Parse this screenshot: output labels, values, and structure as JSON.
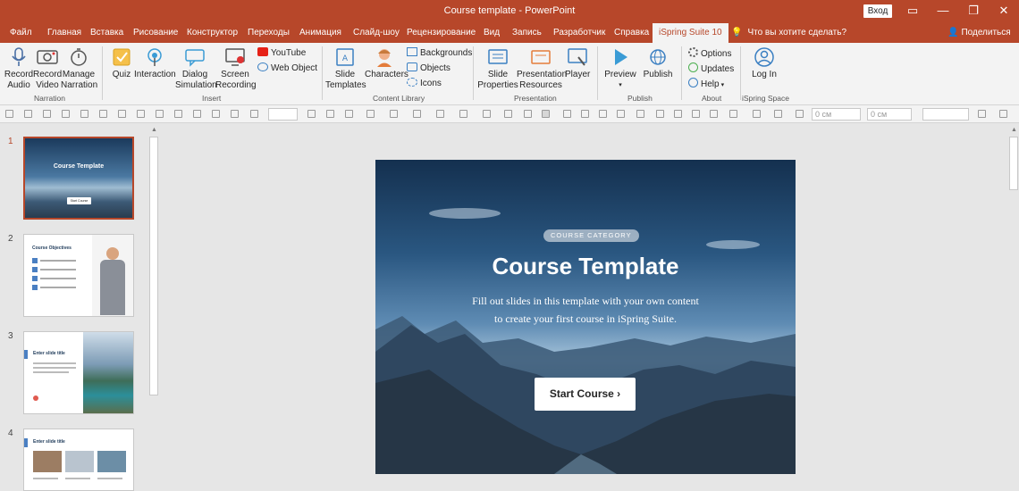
{
  "window": {
    "title": "Course template  -  PowerPoint",
    "login_label": "Вход",
    "controls": [
      "restore-ribbon",
      "minimize",
      "maximize",
      "close"
    ]
  },
  "tabs": [
    "Файл",
    "Главная",
    "Вставка",
    "Рисование",
    "Конструктор",
    "Переходы",
    "Анимация",
    "Слайд-шоу",
    "Рецензирование",
    "Вид",
    "Запись",
    "Разработчик",
    "Справка",
    "iSpring Suite 10"
  ],
  "active_tab": "iSpring Suite 10",
  "tell_me": "Что вы хотите сделать?",
  "share_label": "Поделиться",
  "ribbon": {
    "narration": {
      "record_audio": "Record Audio",
      "record_video": "Record Video",
      "manage_narration": "Manage Narration",
      "group": "Narration"
    },
    "insert": {
      "quiz": "Quiz",
      "interaction": "Interaction",
      "dialog_simulation": "Dialog Simulation",
      "screen_recording": "Screen Recording",
      "youtube": "YouTube",
      "web_object": "Web Object",
      "group": "Insert"
    },
    "content_library": {
      "slide_templates": "Slide Templates",
      "characters": "Characters",
      "backgrounds": "Backgrounds",
      "objects": "Objects",
      "icons": "Icons",
      "group": "Content Library"
    },
    "presentation": {
      "slide_properties": "Slide Properties",
      "presentation_resources": "Presentation Resources",
      "player": "Player",
      "group": "Presentation"
    },
    "publish": {
      "preview": "Preview",
      "publish": "Publish",
      "group": "Publish"
    },
    "about": {
      "options": "Options",
      "updates": "Updates",
      "help": "Help",
      "group": "About"
    },
    "ispring_space": {
      "log_in": "Log In",
      "group": "iSpring Space"
    }
  },
  "toolbar": {
    "left_cm": "0 см",
    "top_cm": "0 см"
  },
  "thumbnails": [
    {
      "num": "1",
      "title": "Course Template",
      "button": "Start Course"
    },
    {
      "num": "2",
      "title": "Course Objectives"
    },
    {
      "num": "3",
      "title": "Enter slide title"
    },
    {
      "num": "4",
      "title": "Enter slide title"
    }
  ],
  "slide": {
    "category": "COURSE CATEGORY",
    "title": "Course Template",
    "subtitle_line1": "Fill out slides in this template with your own content",
    "subtitle_line2": "to create your first course in iSpring Suite.",
    "cta": "Start Course ›"
  },
  "colors": {
    "accent": "#b7472a",
    "ribbon_bg": "#f3f3f3",
    "canvas_bg": "#e6e6e6"
  }
}
